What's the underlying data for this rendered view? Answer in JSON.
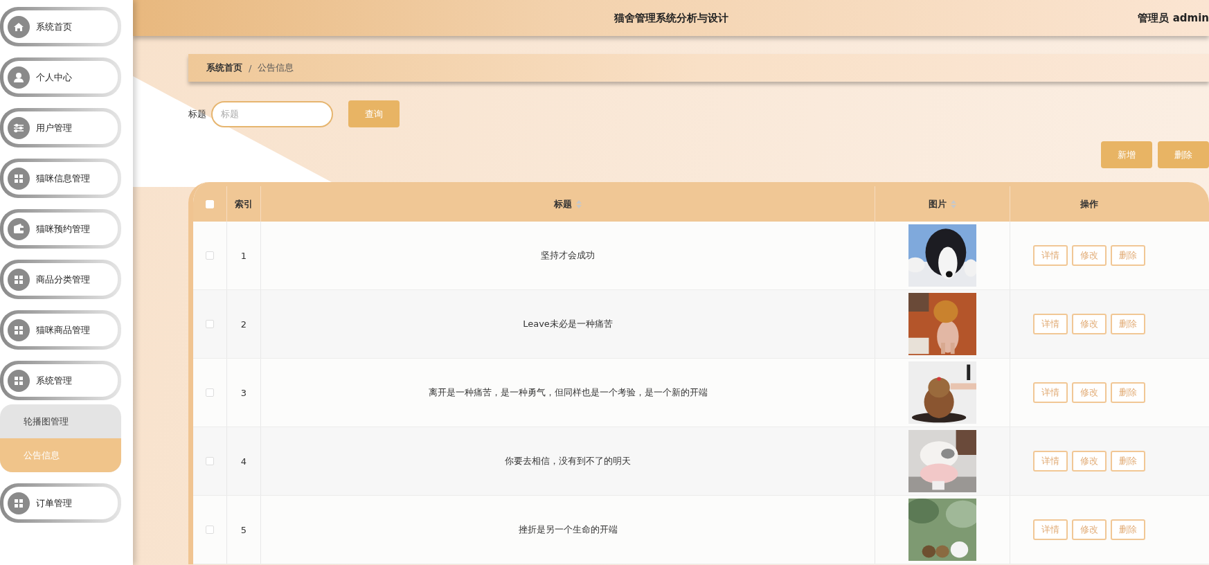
{
  "sidebar": {
    "items": [
      {
        "label": "系统首页",
        "selected": false
      },
      {
        "label": "个人中心",
        "selected": false
      },
      {
        "label": "用户管理",
        "selected": false
      },
      {
        "label": "猫咪信息管理",
        "selected": false
      },
      {
        "label": "猫咪预约管理",
        "selected": false
      },
      {
        "label": "商品分类管理",
        "selected": false
      },
      {
        "label": "猫咪商品管理",
        "selected": false
      },
      {
        "label": "系统管理",
        "selected": false,
        "expanded": true,
        "children": [
          {
            "label": "轮播图管理",
            "selected": false
          },
          {
            "label": "公告信息",
            "selected": true
          }
        ]
      },
      {
        "label": "订单管理",
        "selected": false
      }
    ]
  },
  "header": {
    "title": "猫舍管理系统分析与设计",
    "user": "管理员 admin"
  },
  "breadcrumb": {
    "items": [
      "系统首页",
      "公告信息"
    ],
    "separator": "/"
  },
  "search": {
    "label": "标题",
    "placeholder": "标题",
    "button": "查询"
  },
  "toolbar": {
    "buttons": [
      "新增",
      "删除"
    ]
  },
  "table": {
    "select_all_checked": false,
    "columns": [
      {
        "label": "索引",
        "sortable": false
      },
      {
        "label": "标题",
        "sortable": true
      },
      {
        "label": "图片",
        "sortable": true
      },
      {
        "label": "操作",
        "sortable": false
      }
    ],
    "rows": [
      {
        "checked": false,
        "index": "1",
        "title": "坚持才会成功",
        "actions": [
          "详情",
          "修改",
          "删除"
        ]
      },
      {
        "checked": false,
        "index": "2",
        "title": "Leave未必是一种痛苦",
        "actions": [
          "详情",
          "修改",
          "删除"
        ]
      },
      {
        "checked": false,
        "index": "3",
        "title": "离开是一种痛苦，是一种勇气，但同样也是一个考验，是一个新的开端",
        "actions": [
          "详情",
          "修改",
          "删除"
        ]
      },
      {
        "checked": false,
        "index": "4",
        "title": "你要去相信，没有到不了的明天",
        "actions": [
          "详情",
          "修改",
          "删除"
        ]
      },
      {
        "checked": false,
        "index": "5",
        "title": "挫折是另一个生命的开端",
        "actions": [
          "详情",
          "修改",
          "删除"
        ]
      }
    ]
  }
}
